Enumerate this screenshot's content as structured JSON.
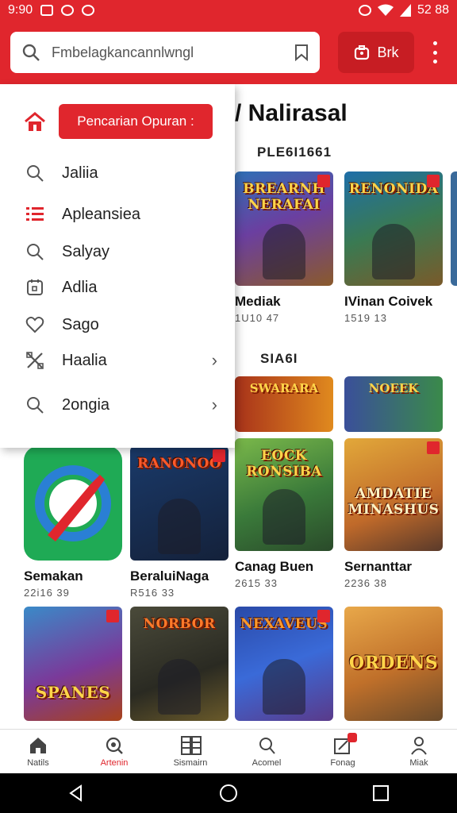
{
  "status_bar": {
    "time": "9:90",
    "battery": "52 88"
  },
  "header": {
    "search_placeholder": "Fmbelagkancannlwngl",
    "button_label": "Brk"
  },
  "drawer": {
    "primary_button": "Pencarian Opuran :",
    "items": [
      {
        "label": "Jaliia",
        "icon": "search-icon"
      },
      {
        "label": "Apleansiea",
        "icon": "list-icon"
      },
      {
        "label": "Salyay",
        "icon": "search-icon"
      },
      {
        "label": "Adlia",
        "icon": "calendar-icon"
      },
      {
        "label": "Sago",
        "icon": "heart-icon"
      },
      {
        "label": "Haalia",
        "icon": "tools-icon",
        "chevron": true
      },
      {
        "label": "2ongia",
        "icon": "search-icon",
        "chevron": true
      }
    ]
  },
  "main": {
    "section_title": "/ Nalirasal",
    "subsection_1": "PLE6I1661",
    "subsection_2": "SIA6I",
    "row1": [
      {
        "art": "BREARNH NERAFAI",
        "title": "Mediak",
        "meta": "1U10 47"
      },
      {
        "art": "RENONIDA",
        "title": "IVinan Coivek",
        "meta": "1519 13"
      }
    ],
    "banners": [
      {
        "art": "SWARARA"
      },
      {
        "art": "NOEEK"
      }
    ],
    "row3": [
      {
        "art": "",
        "title": "Semakan",
        "meta": "22i16 39"
      },
      {
        "art": "RANONOO",
        "title": "BeraluiNaga",
        "meta": "R516 33"
      },
      {
        "art": "EOCK RONSIBA",
        "title": "Canag Buen",
        "meta": "2615 33"
      },
      {
        "art": "AMDATIE MINASHUS",
        "title": "Sernanttar",
        "meta": "2236 38"
      }
    ],
    "row4": [
      {
        "art": "SPANES"
      },
      {
        "art": "NORBOR"
      },
      {
        "art": "NEXAVEUS"
      },
      {
        "art": "ORDENS"
      }
    ]
  },
  "bottom_nav": [
    {
      "label": "Natils",
      "icon": "home-icon"
    },
    {
      "label": "Artenin",
      "icon": "search-icon",
      "active": true
    },
    {
      "label": "Sismairn",
      "icon": "grid-icon"
    },
    {
      "label": "Acomel",
      "icon": "search-icon"
    },
    {
      "label": "Fonag",
      "icon": "share-icon"
    },
    {
      "label": "Miak",
      "icon": "person-icon"
    }
  ],
  "colors": {
    "accent": "#e0262d"
  }
}
